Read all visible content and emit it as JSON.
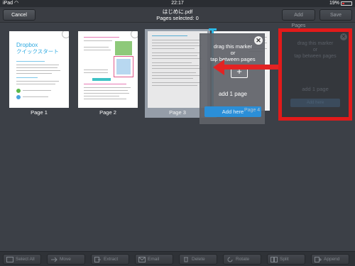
{
  "status_bar": {
    "device": "iPad",
    "time": "22:17",
    "battery": "19%"
  },
  "nav": {
    "cancel_label": "Cancel",
    "filename": "はじめに.pdf",
    "selected": "Pages selected: 0",
    "add_pages_label": "Add Pages",
    "save_label": "Save"
  },
  "pages": [
    {
      "label": "Page 1",
      "title": "Dropbox",
      "subtitle": "クイックスタート"
    },
    {
      "label": "Page 2"
    },
    {
      "label": "Page 3"
    }
  ],
  "popup": {
    "hint_line1": "drag this marker",
    "hint_line2": "or",
    "hint_line3": "tap between pages",
    "plus": "+",
    "add_one": "add 1 page",
    "add_here": "Add here",
    "ghost_page": "Page 4"
  },
  "ghost_popup": {
    "hint_line1": "drag this marker",
    "hint_line2": "or",
    "hint_line3": "tap between pages",
    "add_one": "add 1 page",
    "add_here": "Add here"
  },
  "toolbar": {
    "select_all": "Select All",
    "move": "Move",
    "extract": "Extract",
    "email": "Email",
    "delete": "Delete",
    "rotate": "Rotate",
    "split": "Split",
    "append": "Append"
  },
  "colors": {
    "annotation_red": "#e21a1a",
    "accent_blue": "#2bb8e6",
    "background": "#3c4047"
  }
}
